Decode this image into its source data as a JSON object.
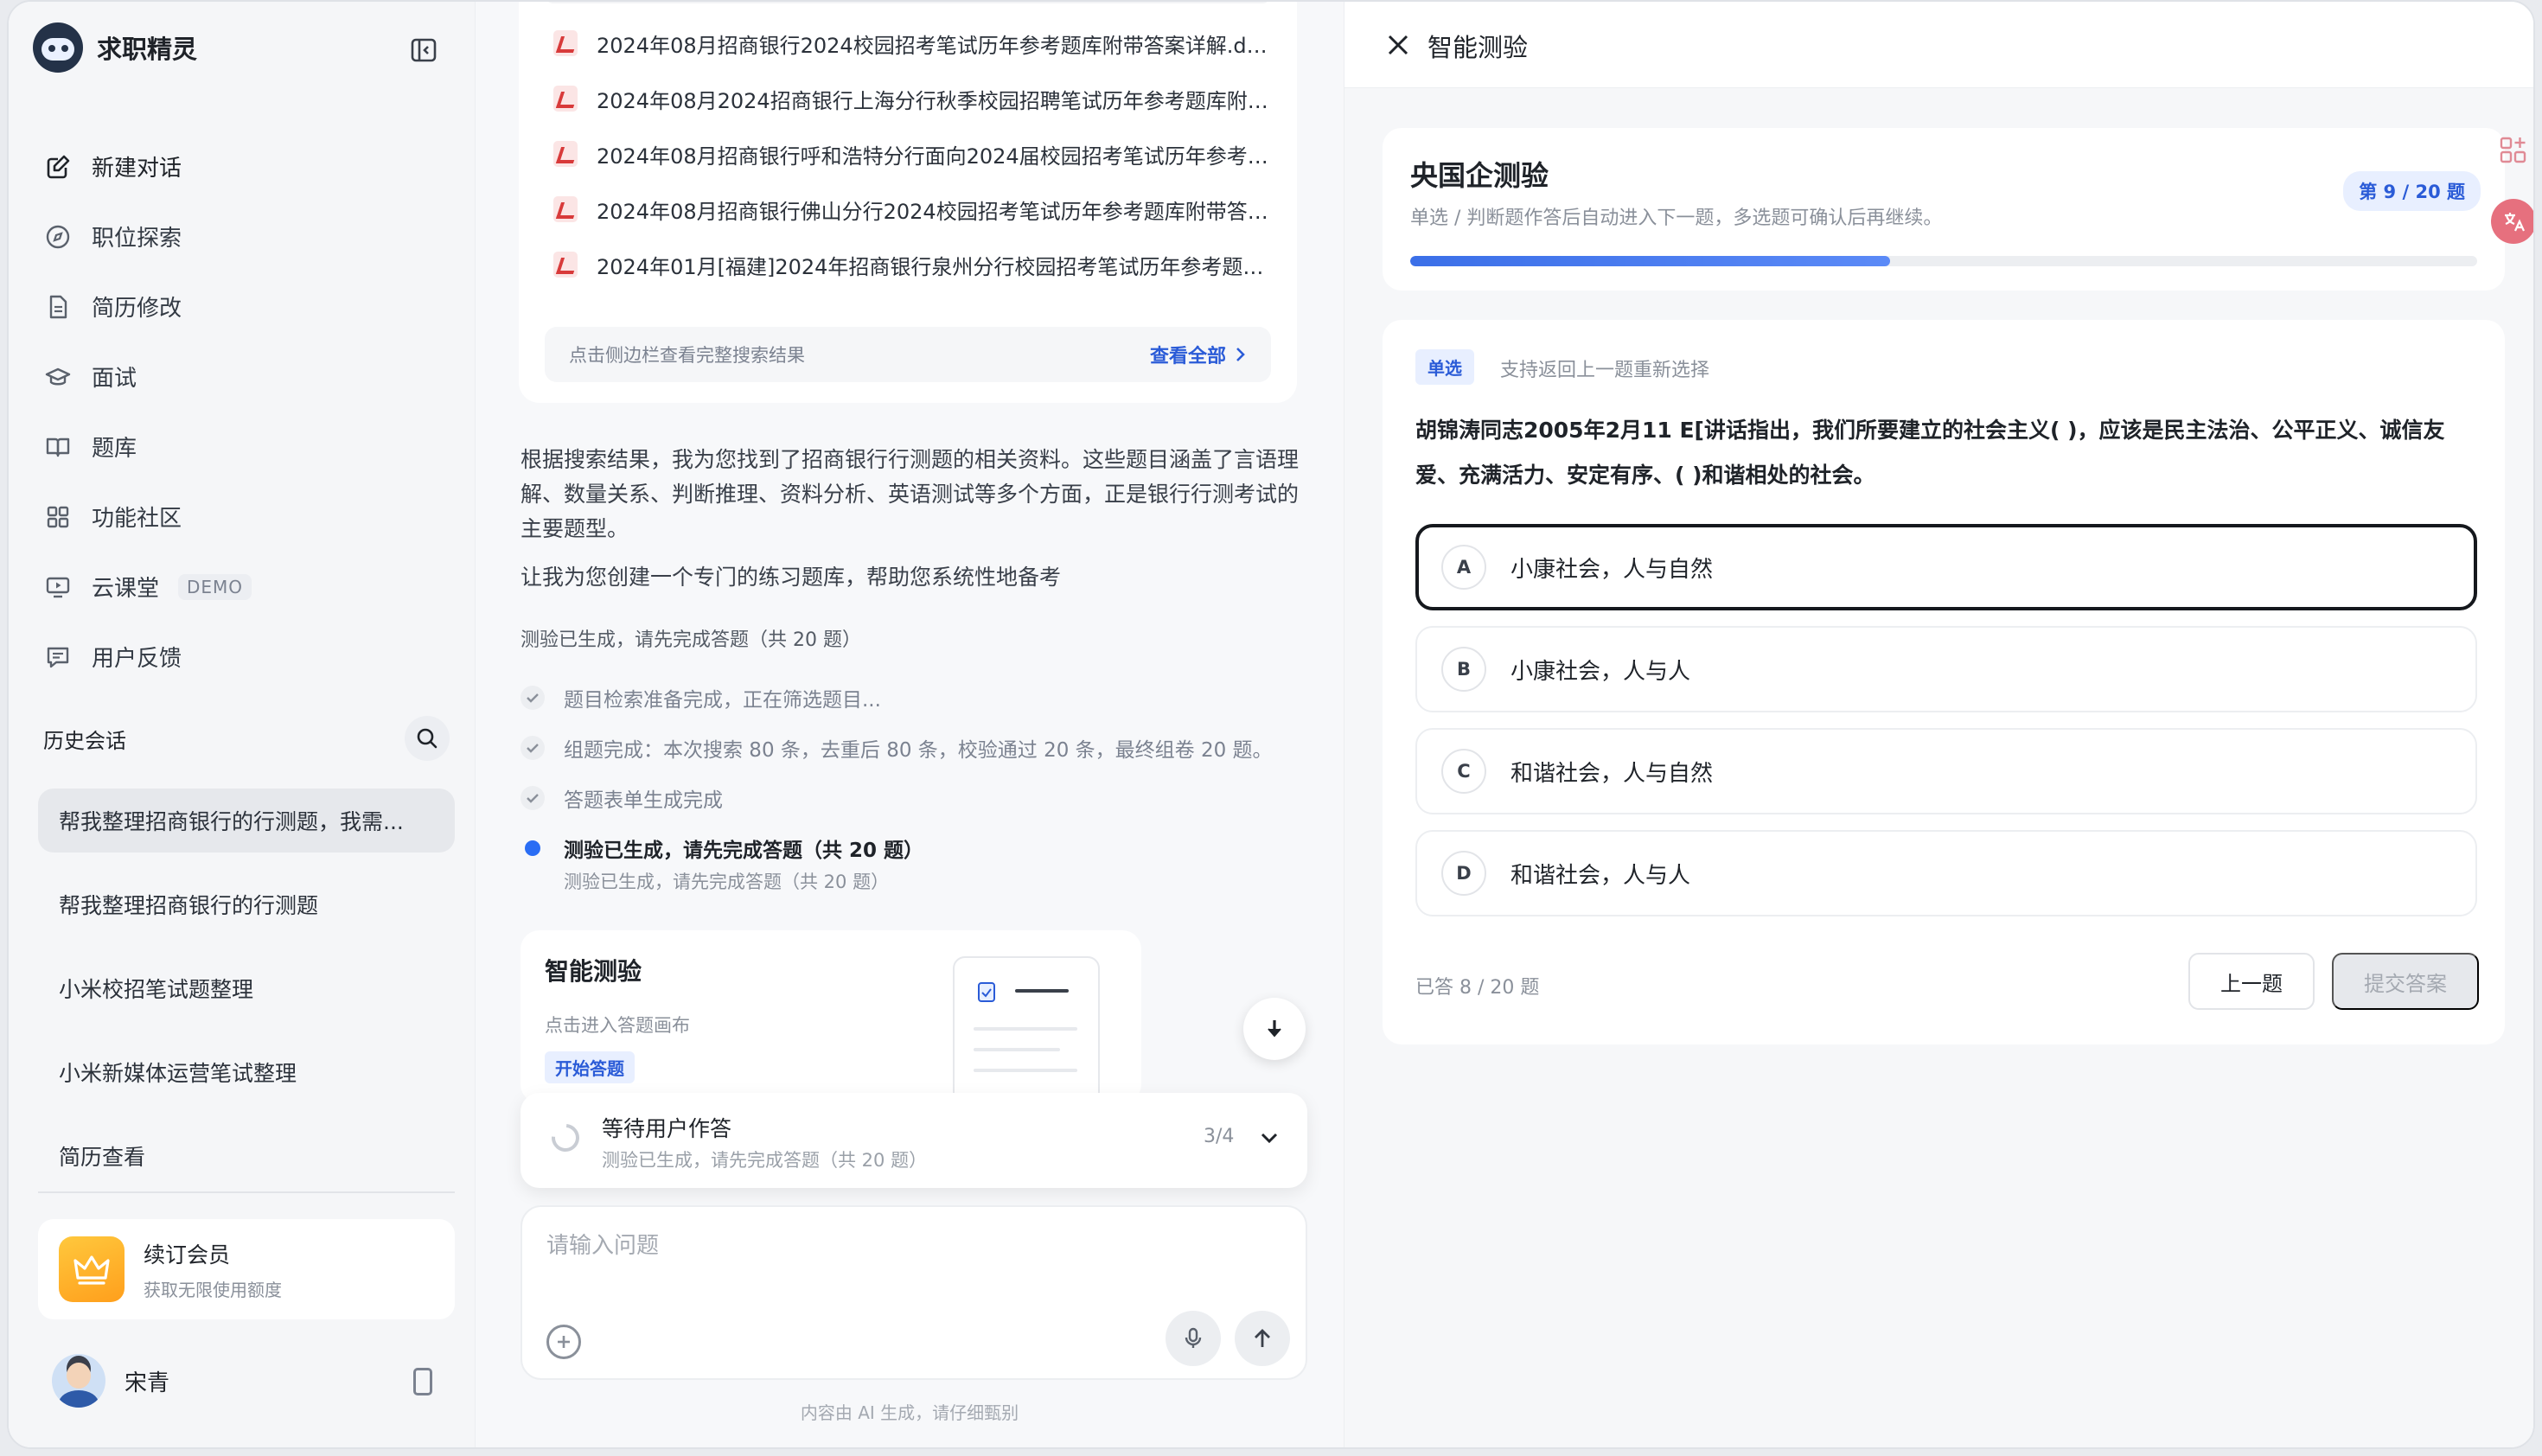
{
  "app": {
    "name": "求职精灵"
  },
  "sidebar": {
    "nav": [
      {
        "label": "新建对话",
        "icon": "edit-icon"
      },
      {
        "label": "职位探索",
        "icon": "compass-icon"
      },
      {
        "label": "简历修改",
        "icon": "document-icon"
      },
      {
        "label": "面试",
        "icon": "graduation-cap-icon"
      },
      {
        "label": "题库",
        "icon": "book-icon"
      },
      {
        "label": "功能社区",
        "icon": "grid-icon"
      },
      {
        "label": "云课堂",
        "icon": "monitor-play-icon",
        "badge": "DEMO"
      },
      {
        "label": "用户反馈",
        "icon": "feedback-icon"
      }
    ],
    "history_title": "历史会话",
    "history": [
      "帮我整理招商银行的行测题，我需...",
      "帮我整理招商银行的行测题",
      "小米校招笔试题整理",
      "小米新媒体运营笔试整理",
      "简历查看"
    ],
    "member": {
      "title": "续订会员",
      "subtitle": "获取无限使用额度"
    },
    "user": {
      "name": "宋青"
    }
  },
  "chat": {
    "search_results": [
      "2024年08月招商银行2024校园招考笔试历年参考题库附带答案详解.doc...",
      "2024年08月2024招商银行上海分行秋季校园招聘笔试历年参考题库附带...",
      "2024年08月招商银行呼和浩特分行面向2024届校园招考笔试历年参考题...",
      "2024年08月招商银行佛山分行2024校园招考笔试历年参考题库附带答案...",
      "2024年01月[福建]2024年招商银行泉州分行校园招考笔试历年参考题库..."
    ],
    "search_hint": "点击侧边栏查看完整搜索结果",
    "view_all": "查看全部",
    "answer_p1": "根据搜索结果，我为您找到了招商银行行测题的相关资料。这些题目涵盖了言语理解、数量关系、判断推理、资料分析、英语测试等多个方面，正是银行行测考试的主要题型。",
    "answer_p2": "让我为您创建一个专门的练习题库，帮助您系统性地备考",
    "steps_header": "测验已生成，请先完成答题（共 20 题）",
    "steps": [
      "题目检索准备完成，正在筛选题目...",
      "组题完成：本次搜索 80 条，去重后 80 条，校验通过 20 条，最终组卷 20 题。",
      "答题表单生成完成"
    ],
    "current_step": "测验已生成，请先完成答题（共 20 题）",
    "current_step_sub": "测验已生成，请先完成答题（共 20 题）",
    "quiz_card": {
      "title": "智能测验",
      "subtitle": "点击进入答题画布",
      "badge": "开始答题"
    },
    "status": {
      "title": "等待用户作答",
      "subtitle": "测验已生成，请先完成答题（共 20 题）",
      "count": "3/4"
    },
    "input_placeholder": "请输入问题",
    "disclaimer": "内容由 AI 生成，请仔细甄别"
  },
  "panel": {
    "title": "智能测验",
    "exam": {
      "title": "央国企测验",
      "subtitle": "单选 / 判断题作答后自动进入下一题，多选题可确认后再继续。",
      "position": "第 9 / 20 题",
      "progress": 0.45
    },
    "question": {
      "type": "单选",
      "hint": "支持返回上一题重新选择",
      "text": "胡锦涛同志2005年2月11 E[讲话指出，我们所要建立的社会主义( )，应该是民主法治、公平正义、诚信友爱、充满活力、安定有序、( )和谐相处的社会。",
      "options": [
        {
          "letter": "A",
          "text": "小康社会，人与自然",
          "selected": true
        },
        {
          "letter": "B",
          "text": "小康社会，人与人",
          "selected": false
        },
        {
          "letter": "C",
          "text": "和谐社会，人与自然",
          "selected": false
        },
        {
          "letter": "D",
          "text": "和谐社会，人与人",
          "selected": false
        }
      ],
      "answered": "已答 8 / 20 题",
      "prev_label": "上一题",
      "submit_label": "提交答案"
    }
  },
  "colors": {
    "accent": "#2a5bd7",
    "progress": "#3b6fe8",
    "selected_border": "#15181d"
  }
}
